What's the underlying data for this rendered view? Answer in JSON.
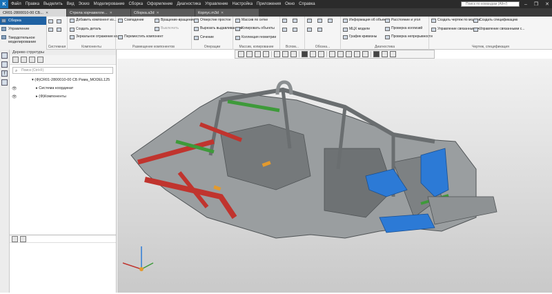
{
  "menu": [
    "Файл",
    "Правка",
    "Выделить",
    "Вид",
    "Эскиз",
    "Моделирование",
    "Сборка",
    "Оформление",
    "Диагностика",
    "Управление",
    "Настройка",
    "Приложения",
    "Окно",
    "Справка"
  ],
  "search_placeholder": "Поиск по командам (Alt+/)",
  "doc_tabs": [
    {
      "label": "CR01-2800010-00 СБ..."
    },
    {
      "label": "Стрела хорчавелле..."
    },
    {
      "label": "Сборка.a3d"
    },
    {
      "label": "Корпус.m3d"
    }
  ],
  "left_modes": [
    "Сборка",
    "Управление",
    "Твердотельное моделирование"
  ],
  "ribbon": {
    "groups": [
      "Системная",
      "Компоненты",
      "Размещение компонентов",
      "Операции",
      "Массив, копирование",
      "Вспом...",
      "Обозна...",
      "Диагностика",
      "Чертеж, спецификация"
    ],
    "buttons": {
      "add_component": "Добавить компонент из...",
      "create_part": "Создать деталь",
      "mirror": "Зеркальное отражение ко...",
      "coincidence": "Совпадение",
      "rotation": "Вращение-вращение",
      "distance_dim": "Выключить",
      "move_component": "Переместить компонент",
      "hole": "Отверстие простое",
      "cut": "Вырезать выдавливанием",
      "section": "Сечение",
      "array_grid": "Массив по сетке",
      "copy_objects": "Копировать объекты",
      "geom_collection": "Коллекция геометрии",
      "info": "Информация об объекте",
      "mass_props": "МЦХ модели",
      "graph": "График кривизны",
      "distance_angle": "Расстояние и угол",
      "check_collisions": "Проверка коллизий",
      "check_continuity": "Проверка непрерывности",
      "create_drawing": "Создать чертеж по модели",
      "manage_linked": "Управление связанными ч...",
      "create_spec": "Создать спецификацию",
      "manage_spec": "Управление связанными с..."
    }
  },
  "tree": {
    "title": "Дерево структуры",
    "search_placeholder": "Поиск (Ctrl+F)",
    "root": "(Ф)CR01-2800010-00 СБ Рама_MODEL125",
    "child1": "Система координат",
    "child2": "(Ф)Компоненты"
  },
  "colors": {
    "accent": "#1f62a3",
    "frame_grey": "#8e9294",
    "frame_red": "#c0342e",
    "frame_green": "#3e9a3a",
    "frame_blue": "#2c7ad6",
    "frame_orange": "#e39a2e"
  }
}
